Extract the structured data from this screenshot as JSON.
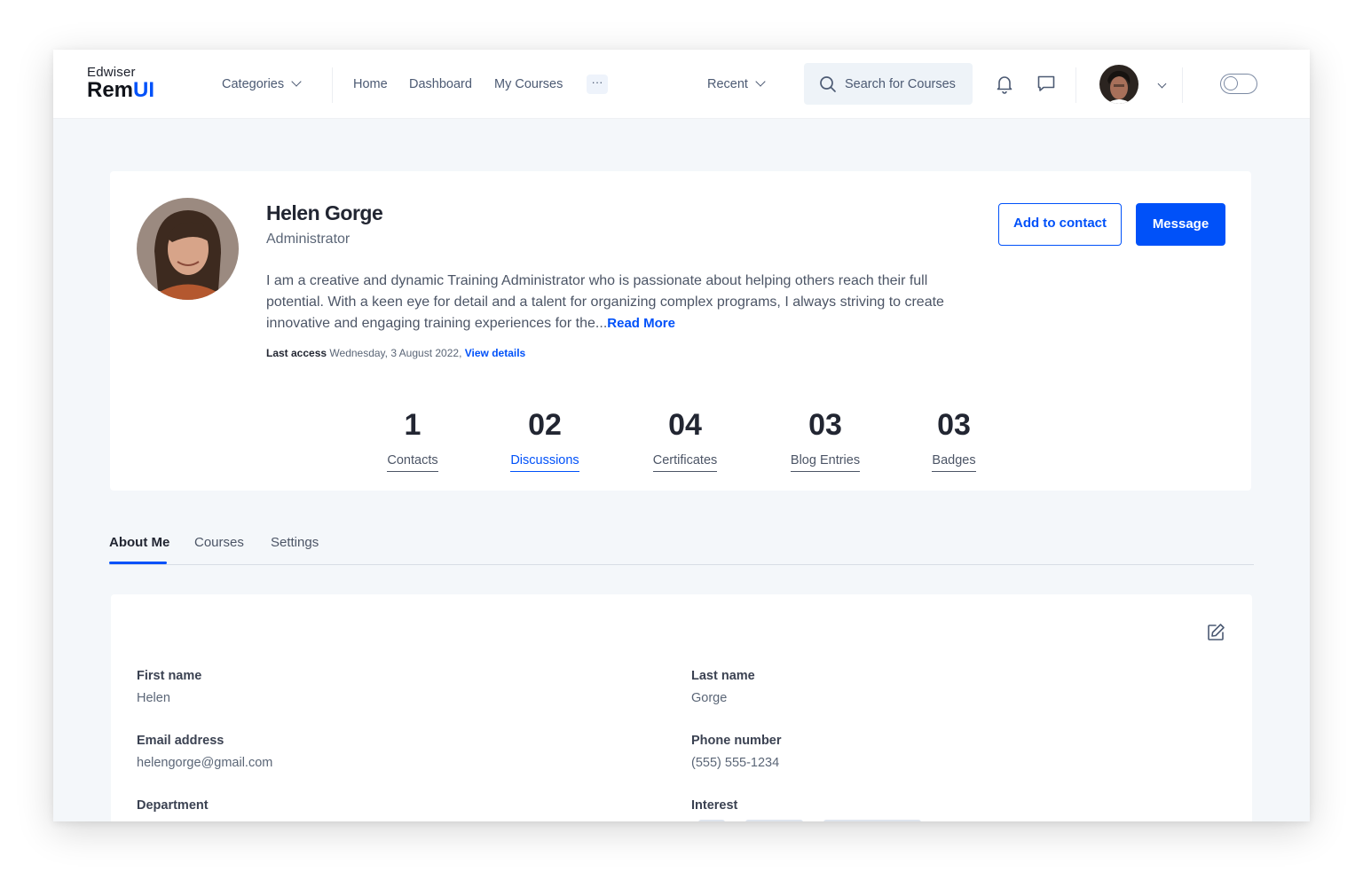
{
  "brand": {
    "top": "Edwiser",
    "main": "Rem",
    "accent": "UI",
    "accent_color": "#0051f9"
  },
  "nav": {
    "categories": "Categories",
    "links": [
      "Home",
      "Dashboard",
      "My Courses"
    ],
    "more": "···",
    "recent": "Recent"
  },
  "search": {
    "placeholder": "Search for Courses"
  },
  "icons": {
    "notifications": "bell-icon",
    "messages": "chat-icon",
    "user_menu": "chevron-down-icon",
    "search": "search-icon",
    "edit": "edit-icon"
  },
  "profile": {
    "name": "Helen Gorge",
    "role": "Administrator",
    "bio": "I am a creative and dynamic Training Administrator who is passionate about helping others reach their full potential. With a keen eye for detail and a talent for organizing complex programs, I always striving to create innovative and engaging training experiences for the...",
    "read_more": "Read More",
    "last_access_label": "Last access",
    "last_access_value": "Wednesday, 3 August 2022,",
    "view_details": "View details",
    "add_contact": "Add to contact",
    "message": "Message"
  },
  "stats": [
    {
      "value": "1",
      "label": "Contacts",
      "active": false
    },
    {
      "value": "02",
      "label": "Discussions",
      "active": true
    },
    {
      "value": "04",
      "label": "Certificates",
      "active": false
    },
    {
      "value": "03",
      "label": "Blog Entries",
      "active": false
    },
    {
      "value": "03",
      "label": "Badges",
      "active": false
    }
  ],
  "tabs": [
    {
      "label": "About Me",
      "active": true
    },
    {
      "label": "Courses",
      "active": false
    },
    {
      "label": "Settings",
      "active": false
    }
  ],
  "about": {
    "first_name_label": "First name",
    "first_name": "Helen",
    "last_name_label": "Last name",
    "last_name": "Gorge",
    "email_label": "Email address",
    "email": "helengorge@gmail.com",
    "phone_label": "Phone number",
    "phone": "(555) 555-1234",
    "department_label": "Department",
    "interest_label": "Interest"
  },
  "colors": {
    "primary": "#0051f9",
    "page_bg": "#f4f7fa",
    "text": "#222632"
  }
}
